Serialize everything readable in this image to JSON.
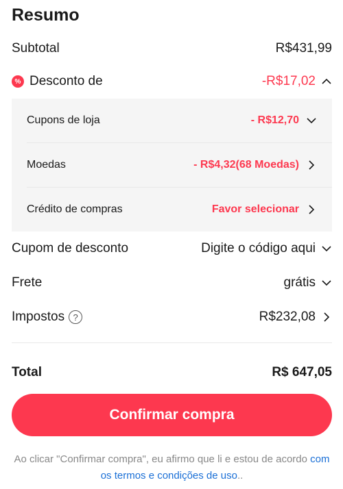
{
  "summary": {
    "title": "Resumo",
    "subtotal": {
      "label": "Subtotal",
      "value": "R$431,99"
    },
    "discount": {
      "badge": "%",
      "label": "Desconto de",
      "value": "-R$17,02"
    },
    "discount_items": [
      {
        "label": "Cupons de loja",
        "value": "- R$12,70"
      },
      {
        "label": "Moedas",
        "value": "- R$4,32(68 Moedas)"
      },
      {
        "label": "Crédito de compras",
        "value": "Favor selecionar"
      }
    ],
    "coupon": {
      "label": "Cupom de desconto",
      "value": "Digite o código aqui"
    },
    "shipping": {
      "label": "Frete",
      "value": "grátis"
    },
    "taxes": {
      "label": "Impostos",
      "help": "?",
      "value": "R$232,08"
    },
    "total": {
      "label": "Total",
      "value": "R$ 647,05"
    }
  },
  "confirm_button": {
    "label": "Confirmar compra"
  },
  "disclaimer": {
    "text": "Ao clicar \"Confirmar compra\", eu afirmo que li e estou de acordo ",
    "link": "com os termos e condições de uso",
    "suffix": ".."
  },
  "colors": {
    "accent": "#fd384f",
    "link": "#1a6fd6",
    "panel": "#f5f5f5"
  }
}
